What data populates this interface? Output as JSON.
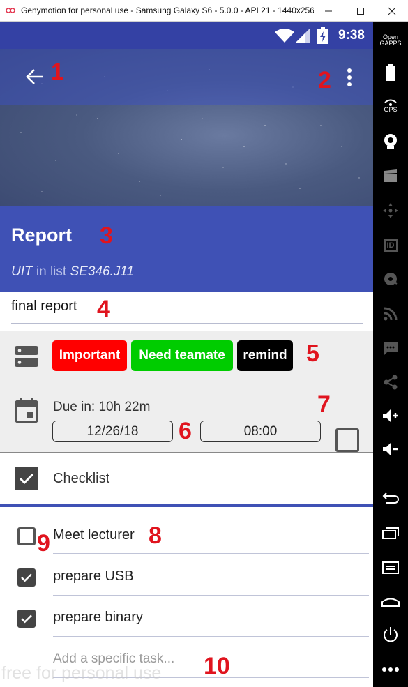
{
  "window": {
    "title": "Genymotion for personal use - Samsung Galaxy S6 - 5.0.0 - API 21 - 1440x256..."
  },
  "status_bar": {
    "time": "9:38"
  },
  "task": {
    "title": "Report",
    "owner": "UIT",
    "in_list_text": "in list",
    "list_name": "SE346.J11",
    "note": "final report"
  },
  "tags": [
    {
      "label": "Important",
      "color": "#ff0000"
    },
    {
      "label": "Need teamate",
      "color": "#00cc00"
    },
    {
      "label": "remind",
      "color": "#000000"
    }
  ],
  "due": {
    "text": "Due in: 10h 22m",
    "date": "12/26/18",
    "time": "08:00",
    "completed": false
  },
  "checklist": {
    "header": "Checklist",
    "header_checked": true,
    "items": [
      {
        "label": "Meet lecturer",
        "checked": false
      },
      {
        "label": "prepare USB",
        "checked": true
      },
      {
        "label": "prepare binary",
        "checked": true
      }
    ],
    "add_placeholder": "Add a specific task..."
  },
  "annotations": [
    "1",
    "2",
    "3",
    "4",
    "5",
    "6",
    "7",
    "8",
    "9",
    "10"
  ],
  "watermark": "free for personal use",
  "sidebar": {
    "open_gapps": "Open GAPPS",
    "gps": "GPS",
    "id": "ID"
  },
  "colors": {
    "primary": "#3f51b5",
    "status_bar": "#3441a4",
    "annotation": "#e0141e"
  }
}
